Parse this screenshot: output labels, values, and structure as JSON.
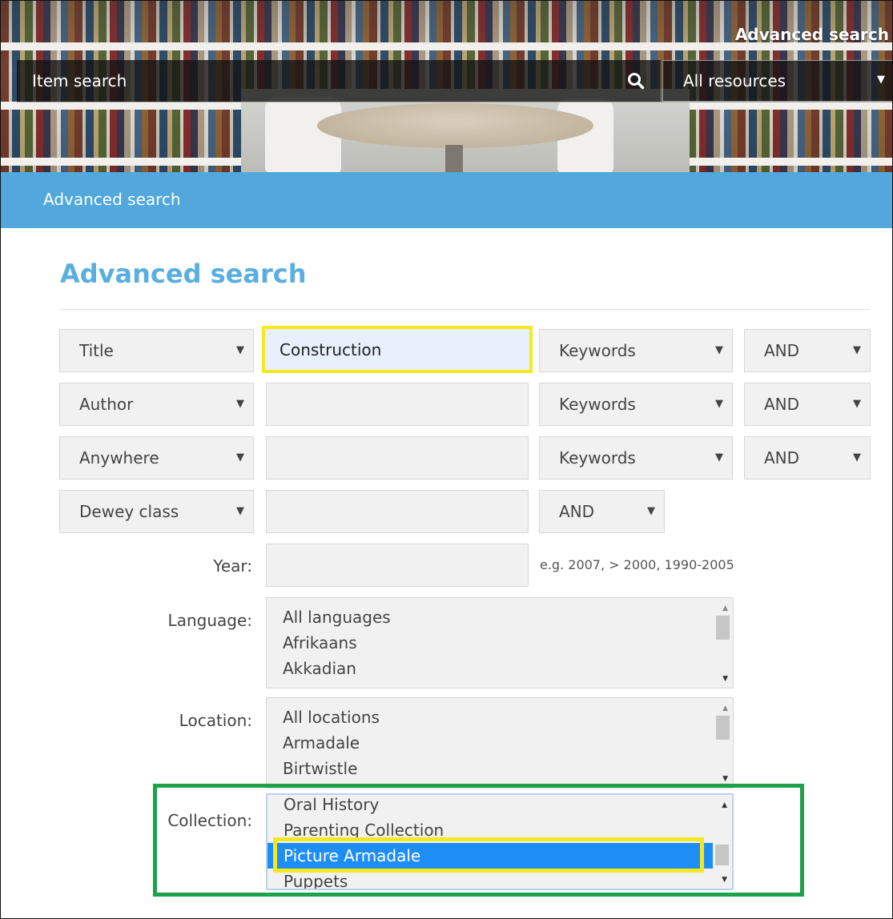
{
  "header": {
    "advanced_link": "Advanced search",
    "search_placeholder": "Item search",
    "resource_select": "All resources"
  },
  "breadcrumb": "Advanced search",
  "page_title": "Advanced search",
  "rows": [
    {
      "field": "Title",
      "value": "Construction",
      "match": "Keywords",
      "op": "AND"
    },
    {
      "field": "Author",
      "value": "",
      "match": "Keywords",
      "op": "AND"
    },
    {
      "field": "Anywhere",
      "value": "",
      "match": "Keywords",
      "op": "AND"
    },
    {
      "field": "Dewey class",
      "value": "",
      "op": "AND"
    }
  ],
  "year": {
    "label": "Year:",
    "hint": "e.g. 2007, > 2000, 1990-2005"
  },
  "language": {
    "label": "Language:",
    "options": [
      "All languages",
      "Afrikaans",
      "Akkadian"
    ]
  },
  "location": {
    "label": "Location:",
    "options": [
      "All locations",
      "Armadale",
      "Birtwistle"
    ]
  },
  "collection": {
    "label": "Collection:",
    "options": [
      "Oral History",
      "Parenting Collection",
      "Picture Armadale",
      "Puppets"
    ],
    "selected": "Picture Armadale"
  },
  "icons": {
    "search": "search-icon",
    "caret": "caret-down-icon"
  },
  "colors": {
    "accent": "#52a8dc",
    "title": "#5aaee0",
    "highlight_yellow": "#f5e81e",
    "highlight_green": "#1fa04a",
    "selected": "#1e8ef5"
  }
}
